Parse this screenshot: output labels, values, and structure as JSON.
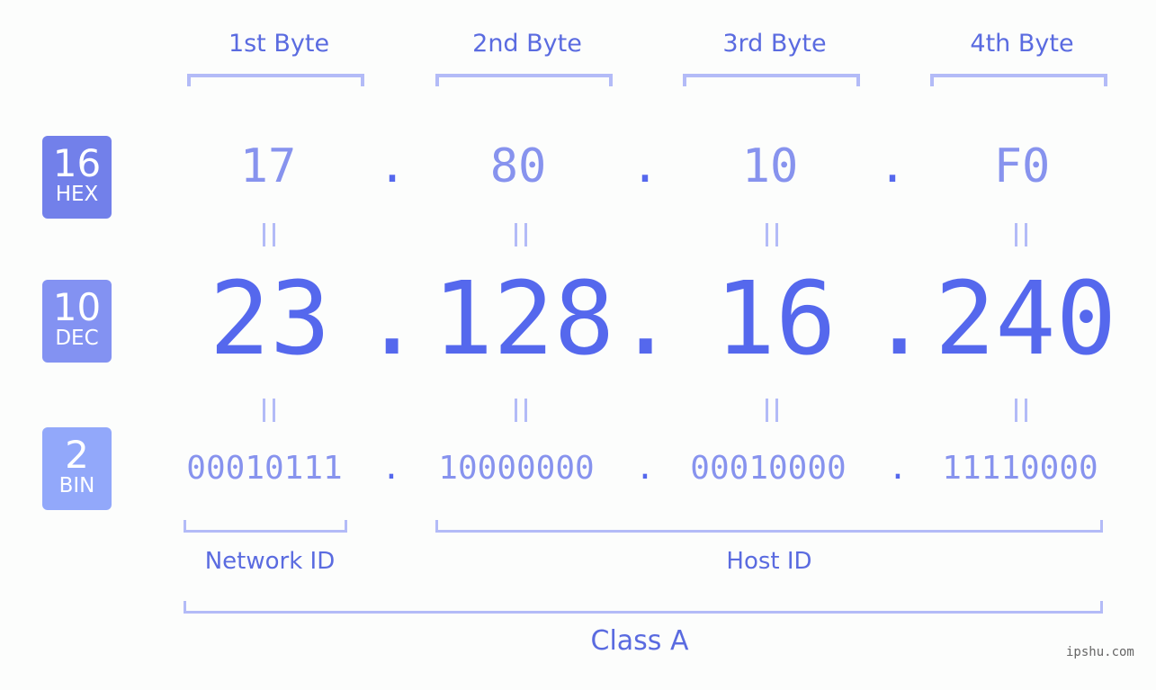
{
  "headers": [
    "1st Byte",
    "2nd Byte",
    "3rd Byte",
    "4th Byte"
  ],
  "badges": {
    "hex": {
      "num": "16",
      "label": "HEX",
      "color": "#7280ea"
    },
    "dec": {
      "num": "10",
      "label": "DEC",
      "color": "#8392f2"
    },
    "bin": {
      "num": "2",
      "label": "BIN",
      "color": "#92a8fa"
    }
  },
  "hex": [
    "17",
    "80",
    "10",
    "F0"
  ],
  "dec": [
    "23",
    "128",
    "16",
    "240"
  ],
  "bin": [
    "00010111",
    "10000000",
    "00010000",
    "11110000"
  ],
  "separator": ".",
  "labels": {
    "network_id": "Network ID",
    "host_id": "Host ID",
    "class": "Class A"
  },
  "watermark": "ipshu.com"
}
